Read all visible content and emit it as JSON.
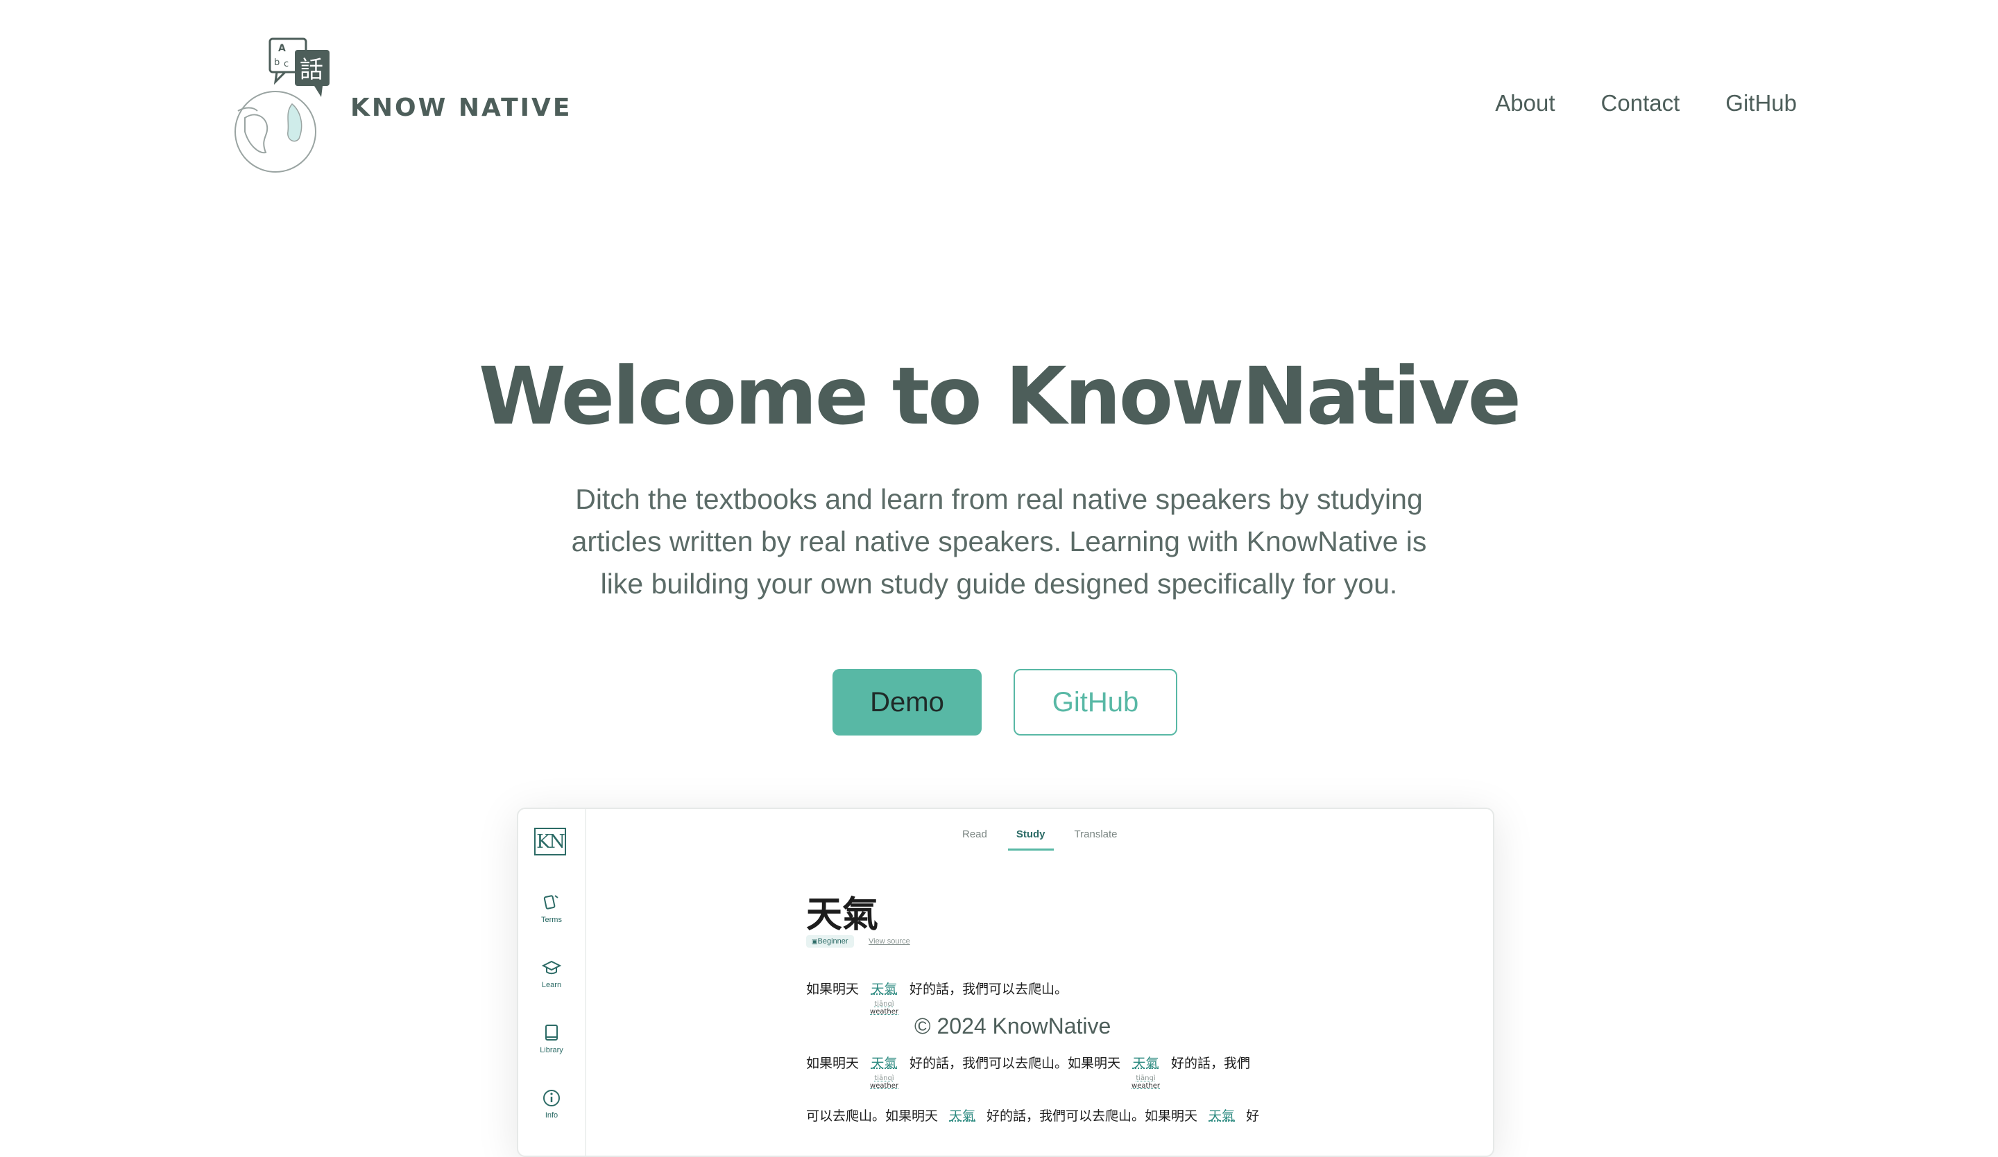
{
  "brand": {
    "logo_text": "KNOW NATIVE",
    "logo_speech_glyphs": "abc",
    "logo_char": "話"
  },
  "nav": {
    "items": [
      "About",
      "Contact",
      "GitHub"
    ]
  },
  "hero": {
    "title": "Welcome to KnowNative",
    "description": "Ditch the textbooks and learn from real native speakers by studying articles written by real native speakers. Learning with KnowNative is like building your own study guide designed specifically for you.",
    "demo_label": "Demo",
    "github_label": "GitHub"
  },
  "preview": {
    "logo": "KN",
    "sidebar": [
      "Terms",
      "Learn",
      "Library",
      "Info"
    ],
    "tabs": [
      "Read",
      "Study",
      "Translate"
    ],
    "active_tab": "Study",
    "term": "天氣",
    "level": "Beginner",
    "view_source": "View source",
    "pinyin": "tiānqì",
    "gloss": "weather",
    "line1": {
      "before": "如果明天",
      "term": "天氣",
      "after": "好的話，我們可以去爬山。"
    },
    "line2": {
      "a": "如果明天",
      "t1": "天氣",
      "b": "好的話，我們可以去爬山。如果明天",
      "t2": "天氣",
      "c": "好的話，我們"
    },
    "line3": {
      "a": "可以去爬山。如果明天",
      "t1": "天氣",
      "b": "好的話，我們可以去爬山。如果明天",
      "t2": "天氣",
      "c": "好"
    }
  },
  "footer": {
    "copyright": "© 2024 KnowNative"
  },
  "colors": {
    "primary": "#4d5e5a",
    "accent": "#58b8a5",
    "teal_dark": "#2c6b66"
  }
}
